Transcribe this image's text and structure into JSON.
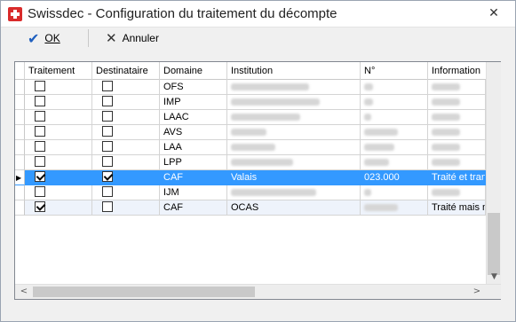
{
  "window": {
    "title": "Swissdec - Configuration du traitement du décompte",
    "close_glyph": "✕"
  },
  "toolbar": {
    "ok_label": "OK",
    "cancel_label": "Annuler"
  },
  "grid": {
    "columns": [
      "Traitement",
      "Destinataire",
      "Domaine",
      "Institution",
      "N°",
      "Information"
    ],
    "rows": [
      {
        "traitement": false,
        "destinataire": false,
        "domaine": "OFS",
        "institution": "",
        "numero": "",
        "information": ""
      },
      {
        "traitement": false,
        "destinataire": false,
        "domaine": "IMP",
        "institution": "",
        "numero": "",
        "information": ""
      },
      {
        "traitement": false,
        "destinataire": false,
        "domaine": "LAAC",
        "institution": "",
        "numero": "",
        "information": ""
      },
      {
        "traitement": false,
        "destinataire": false,
        "domaine": "AVS",
        "institution": "",
        "numero": "",
        "information": ""
      },
      {
        "traitement": false,
        "destinataire": false,
        "domaine": "LAA",
        "institution": "",
        "numero": "",
        "information": ""
      },
      {
        "traitement": false,
        "destinataire": false,
        "domaine": "LPP",
        "institution": "",
        "numero": "",
        "information": ""
      },
      {
        "traitement": true,
        "destinataire": true,
        "domaine": "CAF",
        "institution": "Valais",
        "numero": "023.000",
        "information": "Traité et trans",
        "selected": true
      },
      {
        "traitement": false,
        "destinataire": false,
        "domaine": "IJM",
        "institution": "",
        "numero": "",
        "information": ""
      },
      {
        "traitement": true,
        "destinataire": false,
        "domaine": "CAF",
        "institution": "OCAS",
        "numero": "",
        "information": "Traité mais no",
        "alt": true
      }
    ],
    "row_indicator": "▶"
  },
  "colors": {
    "selection": "#3399ff",
    "alt_row": "#eef3fb",
    "ok_icon": "#1f5fbf"
  }
}
